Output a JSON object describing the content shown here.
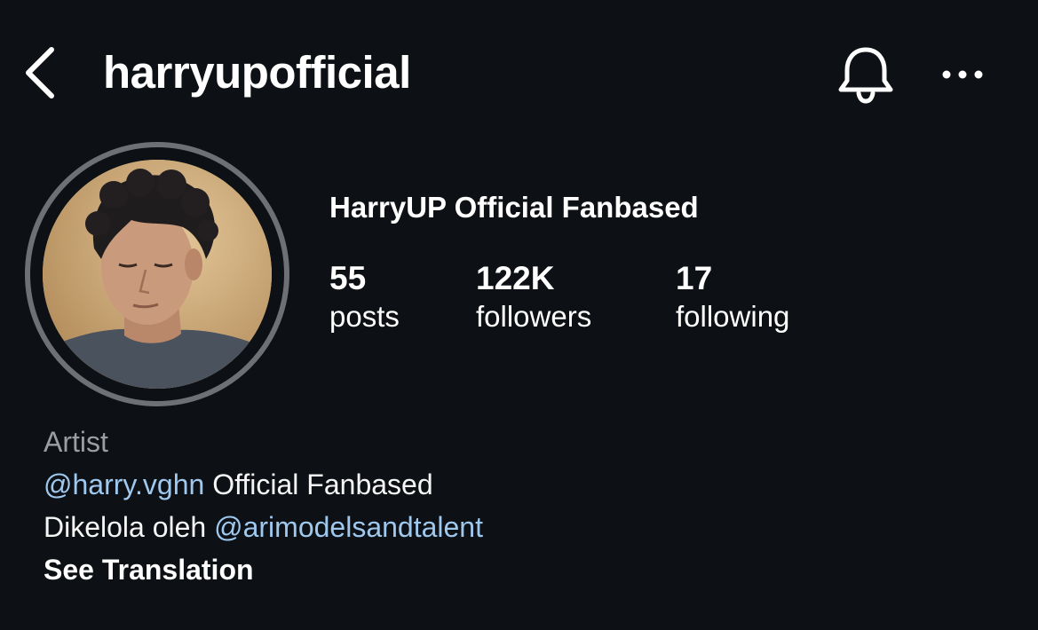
{
  "header": {
    "username": "harryupofficial"
  },
  "profile": {
    "full_name": "HarryUP Official Fanbased",
    "stats": {
      "posts": {
        "value": "55",
        "label": "posts"
      },
      "followers": {
        "value": "122K",
        "label": "followers"
      },
      "following": {
        "value": "17",
        "label": "following"
      }
    }
  },
  "bio": {
    "category": "Artist",
    "line1": {
      "mention": "@harry.vghn",
      "text": " Official Fanbased"
    },
    "line2": {
      "text": "Dikelola oleh ",
      "mention": "@arimodelsandtalent"
    },
    "see_translation": "See Translation"
  },
  "icons": {
    "back": "chevron-left-icon",
    "notifications": "bell-icon",
    "more": "more-horizontal-icon"
  },
  "colors": {
    "background": "#0d1014",
    "text": "#ffffff",
    "muted": "#9a9ea3",
    "link": "#9fc8ef",
    "avatar_ring": "#6d7075"
  }
}
